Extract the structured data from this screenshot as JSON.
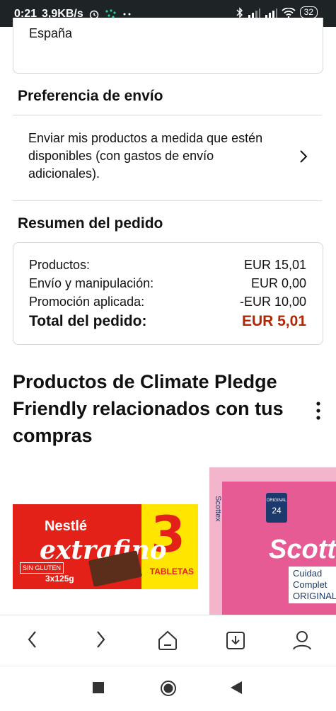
{
  "status_bar": {
    "time": "0:21",
    "speed": "3,9KB/s",
    "battery": "32"
  },
  "address": {
    "country": "España"
  },
  "shipping": {
    "heading": "Preferencia de envío",
    "option_text": "Enviar mis productos a medida que estén disponibles (con gastos de envío adicionales)."
  },
  "summary": {
    "heading": "Resumen del pedido",
    "rows": [
      {
        "label": "Productos:",
        "value": "EUR 15,01"
      },
      {
        "label": "Envío y manipulación:",
        "value": "EUR 0,00"
      },
      {
        "label": "Promoción aplicada:",
        "value": "-EUR 10,00"
      }
    ],
    "total_label": "Total del pedido:",
    "total_value": "EUR 5,01"
  },
  "related": {
    "title": "Productos de Climate Pledge Friendly relacionados con tus compras",
    "product1": {
      "brand": "Nestlé",
      "name": "extrafino",
      "count": "3",
      "pack": "TABLETAS",
      "size": "3x125g",
      "gluten": "SIN GLUTEN"
    },
    "product2": {
      "brand": "Scott",
      "side": "Scottex",
      "rolls": "24",
      "badge_label": "ORIGINAL",
      "sub": "Cuidad Complet ORIGINAL"
    }
  },
  "colors": {
    "total": "#b12704",
    "status_bg": "#1e2326"
  },
  "icons": [
    "back-icon",
    "forward-icon",
    "home-icon",
    "download-icon",
    "profile-icon",
    "square-icon",
    "circle-icon",
    "triangle-back-icon"
  ]
}
